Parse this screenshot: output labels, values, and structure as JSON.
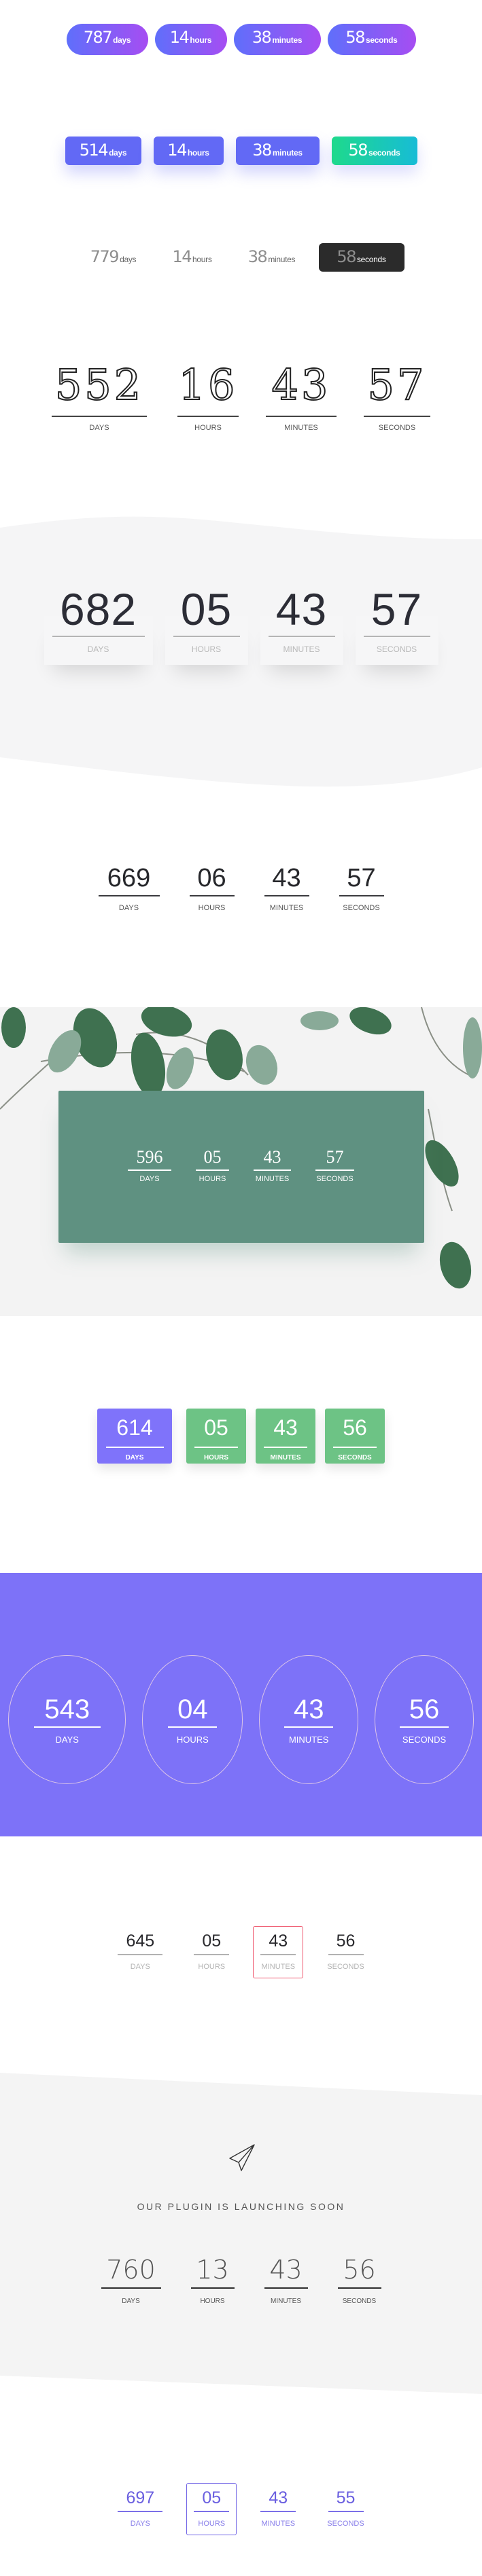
{
  "labels_lower": {
    "days": "days",
    "hours": "hours",
    "minutes": "minutes",
    "seconds": "seconds"
  },
  "labels_upper": {
    "days": "DAYS",
    "hours": "HOURS",
    "minutes": "MINUTES",
    "seconds": "SECONDS"
  },
  "colors": {
    "gradient_pill_start": "#5f6ffb",
    "gradient_pill_end": "#a64df2",
    "box_blue": "#6269f5",
    "box_teal_start": "#1ed98c",
    "box_teal_end": "#17bcd6",
    "dark_box": "#2b2b2b",
    "gray_wave_bg": "#f5f5f6",
    "green_panel": "#5f9181",
    "card_purple": "#7f73fa",
    "card_green": "#6dc385",
    "purple_band": "#7d72f8",
    "highlight_red": "#ef5a70",
    "highlight_purple": "#7468e6"
  },
  "countdowns": [
    {
      "style": "gradient-pills",
      "days": "787",
      "hours": "14",
      "minutes": "38",
      "seconds": "58"
    },
    {
      "style": "blue-boxes-teal-accent",
      "days": "514",
      "hours": "14",
      "minutes": "38",
      "seconds": "58"
    },
    {
      "style": "plain-dark-seconds",
      "days": "779",
      "hours": "14",
      "minutes": "38",
      "seconds": "58"
    },
    {
      "style": "sketch-digits",
      "days": "552",
      "hours": "16",
      "minutes": "43",
      "seconds": "57"
    },
    {
      "style": "gray-wave-cards",
      "days": "682",
      "hours": "05",
      "minutes": "43",
      "seconds": "57"
    },
    {
      "style": "minimal-underline",
      "days": "669",
      "hours": "06",
      "minutes": "43",
      "seconds": "57"
    },
    {
      "style": "green-panel-leaves",
      "days": "596",
      "hours": "05",
      "minutes": "43",
      "seconds": "57"
    },
    {
      "style": "colored-cards",
      "days": "614",
      "hours": "05",
      "minutes": "43",
      "seconds": "56"
    },
    {
      "style": "purple-circles",
      "days": "543",
      "hours": "04",
      "minutes": "43",
      "seconds": "56"
    },
    {
      "style": "red-highlight-minutes",
      "days": "645",
      "hours": "05",
      "minutes": "43",
      "seconds": "56"
    },
    {
      "style": "launching-soon",
      "days": "760",
      "hours": "13",
      "minutes": "43",
      "seconds": "56"
    },
    {
      "style": "purple-highlight-hours",
      "days": "697",
      "hours": "05",
      "minutes": "43",
      "seconds": "55"
    }
  ],
  "launch": {
    "tagline": "OUR PLUGIN IS LAUNCHING SOON",
    "icon": "paper-plane-icon"
  }
}
